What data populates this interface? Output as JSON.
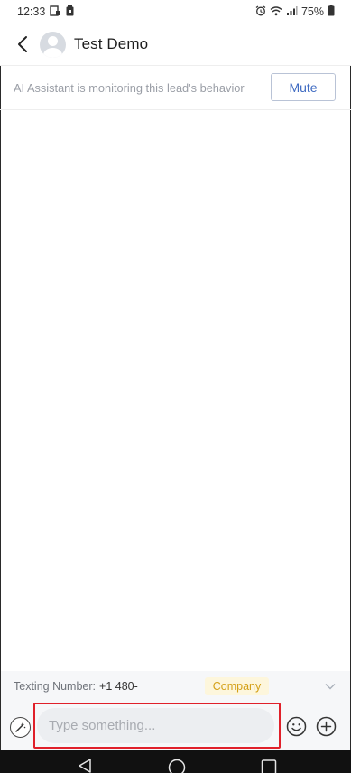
{
  "status_bar": {
    "time": "12:33",
    "battery": "75%"
  },
  "header": {
    "contact_name": "Test Demo"
  },
  "ai_bar": {
    "text": "AI Assistant is monitoring this lead's behavior",
    "mute_label": "Mute"
  },
  "texting": {
    "label": "Texting Number:",
    "number": "+1 480-",
    "badge": "Company"
  },
  "composer": {
    "placeholder": "Type something...",
    "value": ""
  },
  "colors": {
    "accent": "#3f6bc2",
    "badge_text": "#d4a017",
    "badge_bg": "#fdf6dc",
    "highlight": "#e0202a"
  }
}
